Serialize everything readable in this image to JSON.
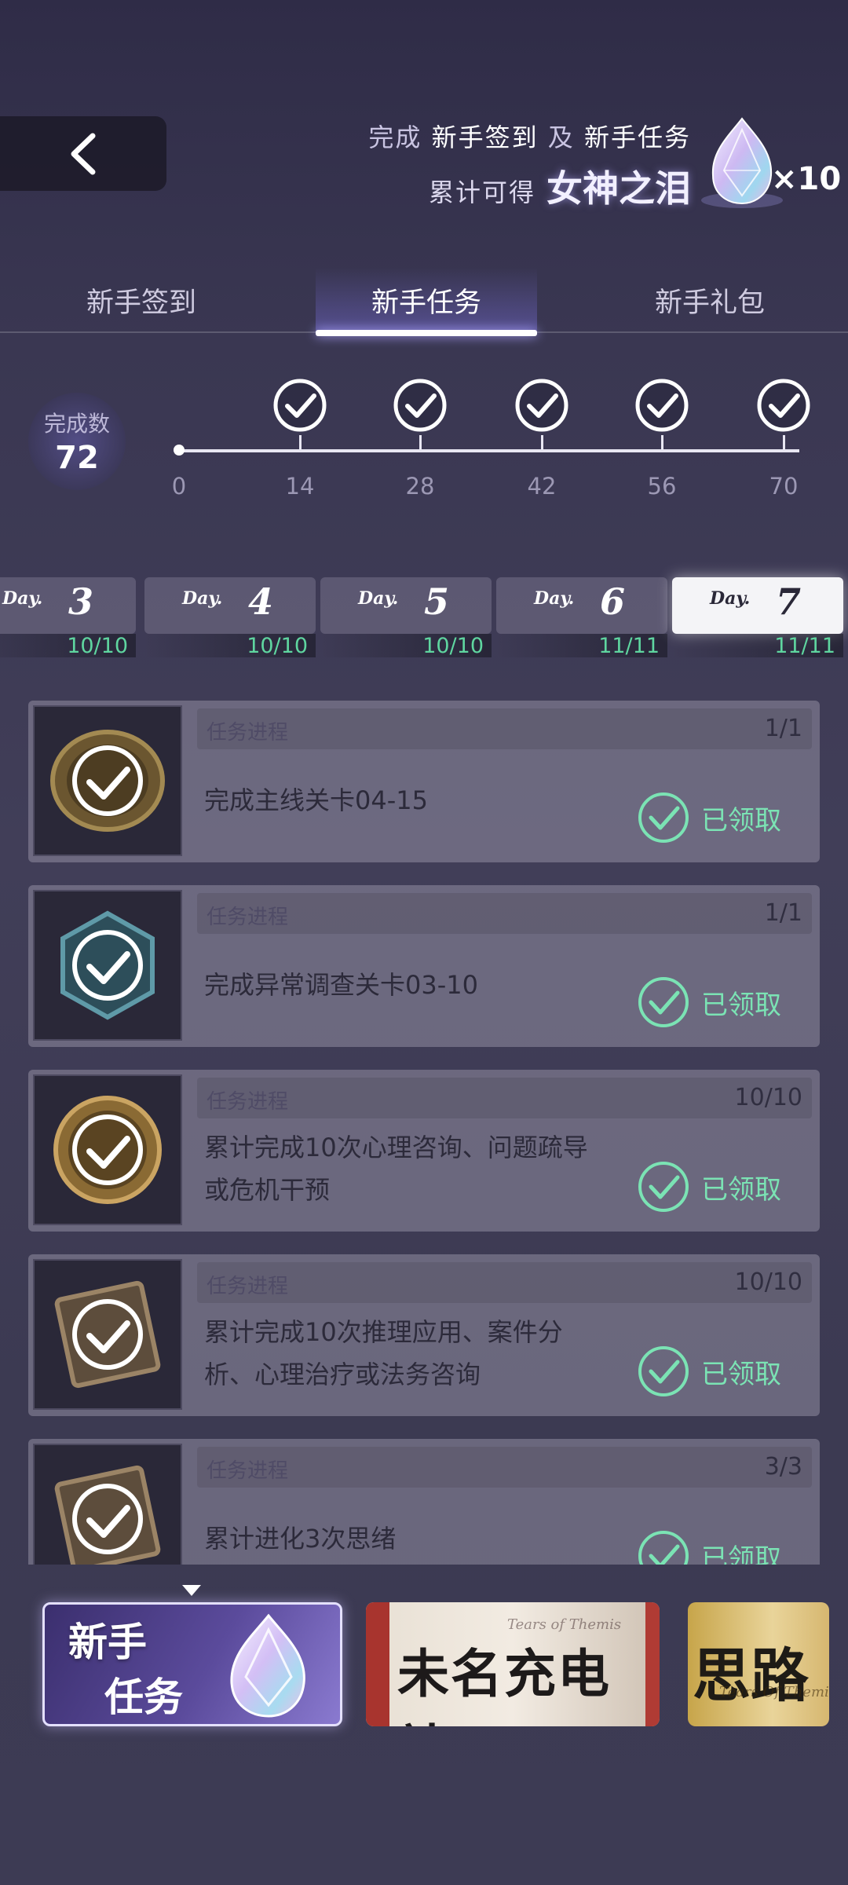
{
  "header": {
    "promo_line1_a": "完成",
    "promo_line1_b": "新手签到",
    "promo_line1_c": "及",
    "promo_line1_d": "新手任务",
    "promo_line2_a": "累计可得",
    "promo_line2_b": "女神之泪",
    "reward_multiplier": "×10"
  },
  "tabs": [
    {
      "label": "新手签到",
      "active": false
    },
    {
      "label": "新手任务",
      "active": true
    },
    {
      "label": "新手礼包",
      "active": false
    }
  ],
  "progress": {
    "count_label": "完成数",
    "count_value": "72",
    "ticks": [
      "0",
      "14",
      "28",
      "42",
      "56",
      "70"
    ],
    "milestones_claimed": 5
  },
  "days": [
    {
      "label": "Day.",
      "num": "3",
      "progress": "10/10",
      "active": false
    },
    {
      "label": "Day.",
      "num": "4",
      "progress": "10/10",
      "active": false
    },
    {
      "label": "Day.",
      "num": "5",
      "progress": "10/10",
      "active": false
    },
    {
      "label": "Day.",
      "num": "6",
      "progress": "11/11",
      "active": false
    },
    {
      "label": "Day.",
      "num": "7",
      "progress": "11/11",
      "active": true
    }
  ],
  "tasks": [
    {
      "header_label": "任务进程",
      "progress": "1/1",
      "desc": "完成主线关卡04-15",
      "status": "已领取",
      "icon": "coin-icon"
    },
    {
      "header_label": "任务进程",
      "progress": "1/1",
      "desc": "完成异常调查关卡03-10",
      "status": "已领取",
      "icon": "hexagon-badge-icon"
    },
    {
      "header_label": "任务进程",
      "progress": "10/10",
      "desc": "累计完成10次心理咨询、问题疏导或危机干预",
      "status": "已领取",
      "icon": "gold-coin-icon"
    },
    {
      "header_label": "任务进程",
      "progress": "10/10",
      "desc": "累计完成10次推理应用、案件分析、心理治疗或法务咨询",
      "status": "已领取",
      "icon": "frame-icon"
    },
    {
      "header_label": "任务进程",
      "progress": "3/3",
      "desc": "累计进化3次思绪",
      "status": "已领取",
      "icon": "frame-icon"
    }
  ],
  "banners": [
    {
      "title_a": "新手",
      "title_b": "任务"
    },
    {
      "title": "未名充电站",
      "watermark": "Tears of Themis"
    },
    {
      "title": "思路",
      "watermark": "Tears Of Themis"
    }
  ],
  "colors": {
    "accent_green": "#5fd6a0",
    "tab_active": "#ffffff",
    "background": "#3c3a52"
  }
}
